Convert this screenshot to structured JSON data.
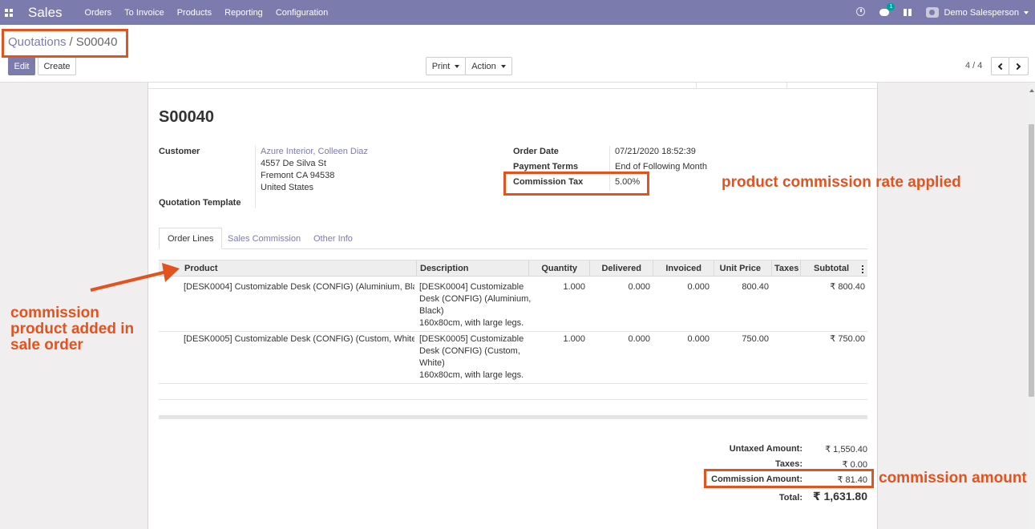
{
  "navbar": {
    "app_name": "Sales",
    "menu": [
      "Orders",
      "To Invoice",
      "Products",
      "Reporting",
      "Configuration"
    ],
    "chat_badge": "1",
    "user_name": "Demo Salesperson",
    "color": "#7c7bad"
  },
  "breadcrumb": {
    "parent": "Quotations",
    "separator": "/",
    "current": "S00040"
  },
  "buttons": {
    "edit": "Edit",
    "create": "Create",
    "print": "Print",
    "action": "Action"
  },
  "pager": {
    "value": "4 / 4"
  },
  "order": {
    "title": "S00040",
    "customer_label": "Customer",
    "customer_name": "Azure Interior, Colleen Diaz",
    "address": [
      "4557 De Silva St",
      "Fremont CA 94538",
      "United States"
    ],
    "template_label": "Quotation Template",
    "order_date_label": "Order Date",
    "order_date": "07/21/2020 18:52:39",
    "payment_terms_label": "Payment Terms",
    "payment_terms": "End of Following Month",
    "commission_tax_label": "Commission Tax",
    "commission_tax": "5.00%"
  },
  "tabs": [
    "Order Lines",
    "Sales Commission",
    "Other Info"
  ],
  "table": {
    "headers": [
      "Product",
      "Description",
      "Quantity",
      "Delivered",
      "Invoiced",
      "Unit Price",
      "Taxes",
      "Subtotal"
    ],
    "rows": [
      {
        "product": "[DESK0004] Customizable Desk (CONFIG) (Aluminium, Bla…",
        "description": [
          "[DESK0004] Customizable",
          "Desk (CONFIG) (Aluminium,",
          "Black)",
          "160x80cm, with large legs."
        ],
        "quantity": "1.000",
        "delivered": "0.000",
        "invoiced": "0.000",
        "unit_price": "800.40",
        "taxes": "",
        "subtotal": "₹ 800.40"
      },
      {
        "product": "[DESK0005] Customizable Desk (CONFIG) (Custom, White)",
        "description": [
          "[DESK0005] Customizable",
          "Desk (CONFIG) (Custom,",
          "White)",
          "160x80cm, with large legs."
        ],
        "quantity": "1.000",
        "delivered": "0.000",
        "invoiced": "0.000",
        "unit_price": "750.00",
        "taxes": "",
        "subtotal": "₹ 750.00"
      }
    ]
  },
  "totals": {
    "untaxed_label": "Untaxed Amount:",
    "untaxed": "₹ 1,550.40",
    "taxes_label": "Taxes:",
    "taxes": "₹ 0.00",
    "commission_label": "Commission Amount:",
    "commission": "₹ 81.40",
    "total_label": "Total:",
    "total": "₹ 1,631.80"
  },
  "annotations": {
    "rate": "product commission rate applied",
    "product": [
      "commission",
      "product added in",
      "sale order"
    ],
    "amount": "commission amount",
    "color": "#e2531f"
  }
}
